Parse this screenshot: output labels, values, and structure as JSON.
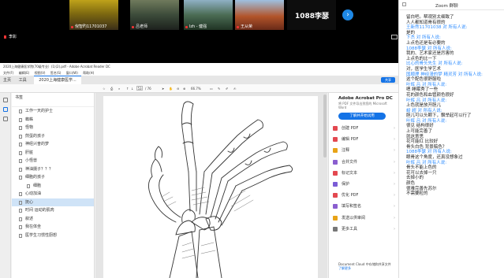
{
  "participants": [
    {
      "name": "倪智旳11701037"
    },
    {
      "name": "吕老师"
    },
    {
      "name": "lzh - 健强"
    },
    {
      "name": "王从荣"
    },
    {
      "name": "1088李瑟"
    }
  ],
  "active_user": "李彰",
  "acrobat": {
    "title": "2020上海健康医学院(70级专业）(1)(2).pdf - Adobe Acrobat Reader DC",
    "menu": [
      "文件(F)",
      "编辑(E)",
      "视图(V)",
      "签名(S)",
      "窗口(W)",
      "帮助(H)"
    ],
    "tabs": [
      "主页",
      "工具"
    ],
    "doc_tab": "2020上海健康医学...",
    "share_label": "共享",
    "page_current": "53",
    "page_total": "/ 76",
    "zoom": "66.7%",
    "bookmarks_title": "书签",
    "bookmarks": [
      {
        "label": "工作一天的护士",
        "indent": 0
      },
      {
        "label": "蜘蛛",
        "indent": 0
      },
      {
        "label": "怪物",
        "indent": 0
      },
      {
        "label": "煎蛋的孩子",
        "indent": 0
      },
      {
        "label": "神经兴奋的梦",
        "indent": 0
      },
      {
        "label": "肝脏",
        "indent": 0
      },
      {
        "label": "小怪兽",
        "indent": 0
      },
      {
        "label": "神油摄子？？？",
        "indent": 0
      },
      {
        "label": "细胞的孩子",
        "indent": 0
      },
      {
        "label": "细胞",
        "indent": 1
      },
      {
        "label": "心动加油",
        "indent": 0
      },
      {
        "label": "抚心",
        "indent": 0
      },
      {
        "label": "时间 运动的肌肉",
        "indent": 0
      },
      {
        "label": "叙述",
        "indent": 0
      },
      {
        "label": "我在体坐",
        "indent": 0
      },
      {
        "label": "医学生习惯性厨想",
        "indent": 0
      }
    ],
    "selected_bookmark": 11,
    "panel": {
      "title": "Adobe Acrobat Pro DC",
      "subtitle": "将 PDF 文件导出到您的 Microsoft Word",
      "try_label": "了解并开始试用",
      "tools": [
        {
          "label": "创建 PDF",
          "color": "#e34850"
        },
        {
          "label": "编辑 PDF",
          "color": "#e34850"
        },
        {
          "label": "注释",
          "color": "#e8a317"
        },
        {
          "label": "合并文件",
          "color": "#8a5ecf"
        },
        {
          "label": "标记文本",
          "color": "#e34850"
        },
        {
          "label": "保护",
          "color": "#7b5cd6"
        },
        {
          "label": "优化 PDF",
          "color": "#e34850"
        },
        {
          "label": "填写和签名",
          "color": "#8a5ecf"
        },
        {
          "label": "发送以供审阅",
          "color": "#e8a317"
        },
        {
          "label": "更多工具",
          "color": "#777777"
        }
      ],
      "footer": "Document Cloud 中存储和共享文件",
      "footer_link": "了解更多"
    }
  },
  "chat": {
    "title": "Zoom 群聊",
    "messages": [
      {
        "from": "",
        "text": "留白吧。帮观別太细致了"
      },
      {
        "from": "",
        "text": "人人都知道骨有很的"
      },
      {
        "from": "王新然11701038 对 所有人说:",
        "text": "是的"
      },
      {
        "from": "下杰 对 所有人说:",
        "text": "上点色还是有必要的"
      },
      {
        "from": "1088李瑟 对 所有人说:",
        "text": "我的、艺术家还是厉害的"
      },
      {
        "from": "",
        "text": "上点色的比一下"
      },
      {
        "from": "比心的骨头先生 对 所有人说:",
        "text": "对，医学生学艺术"
      },
      {
        "from": "国顺理 神经漫的梦 精灵芳 对 所有人说:",
        "text": "这个配色很舒服啦"
      },
      {
        "from": "叶辉 吕 对 所有人说:",
        "text": "嗯 睡眠秀了一些"
      },
      {
        "from": "",
        "text": "花的颜色和血管颜色很好"
      },
      {
        "from": "叶辉 吕 对 所有人说:",
        "text": "上色就是放开胆儿"
      },
      {
        "from": "峻 超 对 所有人说:",
        "text": "胆儿可以头颗下，飘举起可以行了"
      },
      {
        "from": "叶辉 吕 对 所有人说:",
        "text": "很见 结构很好"
      },
      {
        "from": "",
        "text": "上可能完善了"
      },
      {
        "from": "",
        "text": "就这意思"
      },
      {
        "from": "",
        "text": "花可能红 比较好"
      },
      {
        "from": "",
        "text": "骨头白色 背景稿色？"
      },
      {
        "from": "1088李瑟 对 所有人说:",
        "text": "眼骨这个角度，还真没想象过"
      },
      {
        "from": "叶辉 吕 对 所有人说:",
        "text": "骨头不能上色的"
      },
      {
        "from": "",
        "text": "花可以去掉一只"
      },
      {
        "from": "",
        "text": "去掉小的"
      },
      {
        "from": "",
        "text": "颜色"
      },
      {
        "from": "",
        "text": "很难完善先苏尔"
      },
      {
        "from": "",
        "text": "不需要粒的"
      }
    ]
  }
}
